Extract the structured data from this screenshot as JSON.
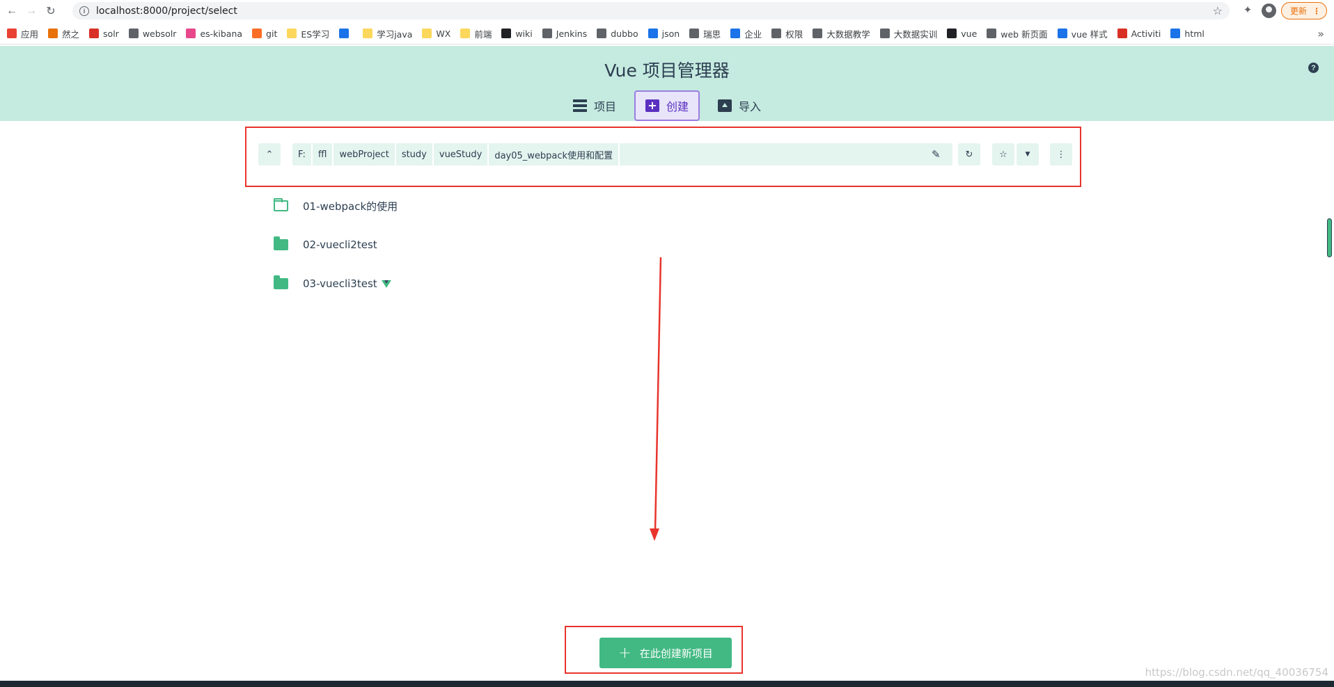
{
  "browser": {
    "url": "localhost:8000/project/select",
    "update_label": "更新",
    "bookmarks": [
      {
        "label": "应用",
        "color": "#e94235"
      },
      {
        "label": "然之",
        "color": "#e8710a"
      },
      {
        "label": "solr",
        "color": "#d93025"
      },
      {
        "label": "websolr",
        "color": "#5f6368"
      },
      {
        "label": "es-kibana",
        "color": "#e8478b"
      },
      {
        "label": "git",
        "color": "#fc6d26"
      },
      {
        "label": "ES学习",
        "color": "#fbd75b"
      },
      {
        "label": "",
        "color": "#1a73e8"
      },
      {
        "label": "学习java",
        "color": "#fbd75b"
      },
      {
        "label": "WX",
        "color": "#fbd75b"
      },
      {
        "label": "前端",
        "color": "#fbd75b"
      },
      {
        "label": "wiki",
        "color": "#202124"
      },
      {
        "label": "Jenkins",
        "color": "#5f6368"
      },
      {
        "label": "dubbo",
        "color": "#5f6368"
      },
      {
        "label": "json",
        "color": "#1a73e8"
      },
      {
        "label": "瑞思",
        "color": "#5f6368"
      },
      {
        "label": "企业",
        "color": "#1a73e8"
      },
      {
        "label": "权限",
        "color": "#5f6368"
      },
      {
        "label": "大数据教学",
        "color": "#5f6368"
      },
      {
        "label": "大数据实训",
        "color": "#5f6368"
      },
      {
        "label": "vue",
        "color": "#202124"
      },
      {
        "label": "web 新页面",
        "color": "#5f6368"
      },
      {
        "label": "vue 样式",
        "color": "#1a73e8"
      },
      {
        "label": "Activiti",
        "color": "#d93025"
      },
      {
        "label": "html",
        "color": "#1a73e8"
      }
    ]
  },
  "app": {
    "title": "Vue 项目管理器",
    "tabs": [
      {
        "label": "项目",
        "active": false
      },
      {
        "label": "创建",
        "active": true
      },
      {
        "label": "导入",
        "active": false
      }
    ]
  },
  "path": {
    "segments": [
      "F:",
      "ffl",
      "webProject",
      "study",
      "vueStudy",
      "day05_webpack使用和配置"
    ]
  },
  "folders": [
    {
      "name": "01-webpack的使用",
      "style": "outline",
      "vue": false
    },
    {
      "name": "02-vuecli2test",
      "style": "filled",
      "vue": false
    },
    {
      "name": "03-vuecli3test",
      "style": "filled",
      "vue": true
    }
  ],
  "create_button_label": "在此创建新项目",
  "watermark": "https://blog.csdn.net/qq_40036754",
  "colors": {
    "header_bg": "#c5eae0",
    "accent_green": "#42b983",
    "active_tab": "#5a30c0",
    "annotation_red": "#e8342c"
  }
}
